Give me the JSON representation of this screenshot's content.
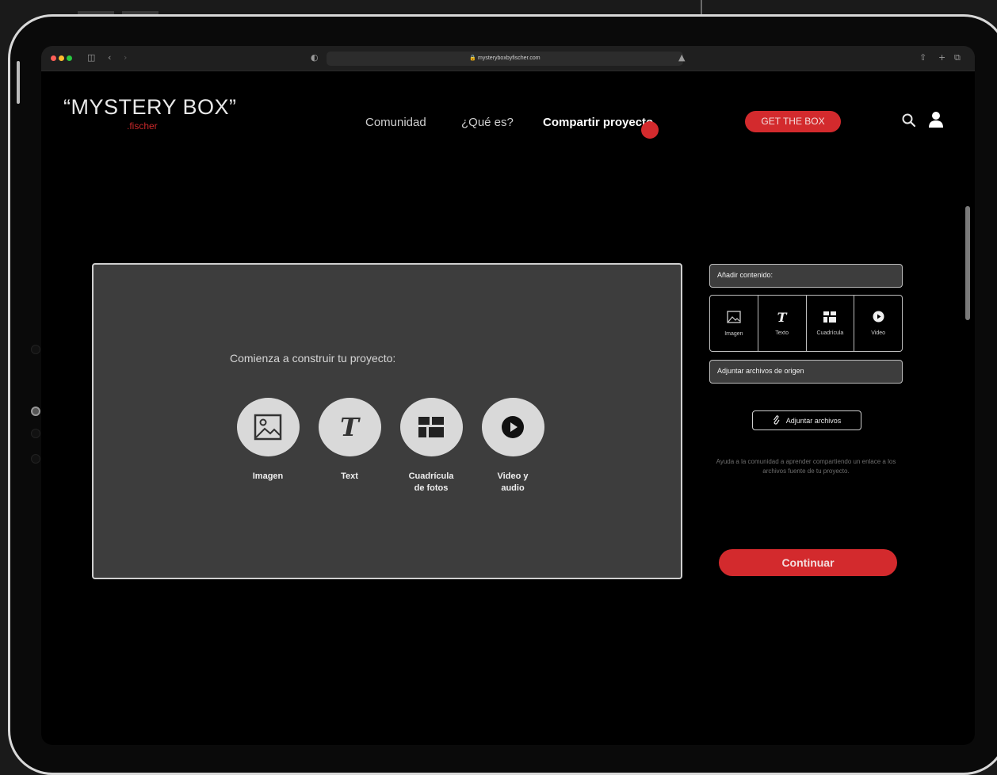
{
  "browser": {
    "url": "mysteryboxbyfischer.com",
    "traffic_light_colors": [
      "#ff5f57",
      "#febc2e",
      "#28c840"
    ]
  },
  "header": {
    "logo": "“MYSTERY BOX”",
    "logo_sub": ".fischer",
    "nav": [
      "Comunidad",
      "¿Qué es?",
      "Compartir proyecto"
    ],
    "active_nav": "Compartir proyecto",
    "cta": "GET THE BOX",
    "icons": [
      "search-icon",
      "user-icon"
    ]
  },
  "canvas": {
    "title": "Comienza a construir tu proyecto:",
    "tools": [
      {
        "label": "Imagen",
        "icon": "image-icon"
      },
      {
        "label": "Text",
        "icon": "text-icon"
      },
      {
        "label": "Cuadrícula\nde fotos",
        "icon": "grid-icon"
      },
      {
        "label": "Video y\naudio",
        "icon": "play-icon"
      }
    ]
  },
  "sidebar": {
    "add_content": "Añadir contenido:",
    "mini_tools": [
      {
        "label": "Imagen",
        "icon": "image-icon"
      },
      {
        "label": "Texto",
        "icon": "text-icon"
      },
      {
        "label": "Cuadrícula",
        "icon": "grid-icon"
      },
      {
        "label": "Video",
        "icon": "play-icon"
      }
    ],
    "attach_source": "Adjuntar archivos de origen",
    "attach_button": "Adjuntar archivos",
    "help_text": "Ayuda a la comunidad a aprender compartiendo un enlace a los archivos fuente de tu proyecto.",
    "continue": "Continuar"
  },
  "colors": {
    "accent": "#d32a2d",
    "panel": "#3d3d3d",
    "background": "#000000"
  }
}
